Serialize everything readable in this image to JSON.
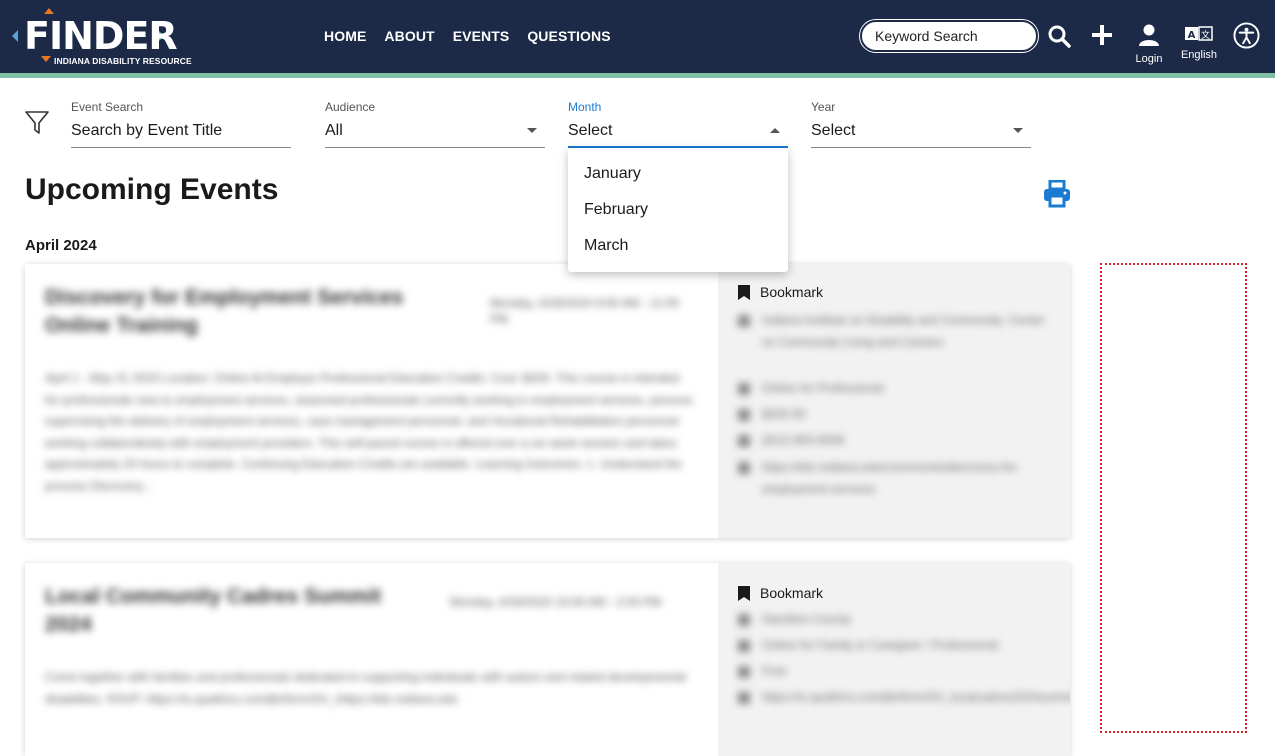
{
  "header": {
    "logo_text": "FINDER",
    "logo_subtext": "INDIANA DISABILITY RESOURCE",
    "nav": [
      "HOME",
      "ABOUT",
      "EVENTS",
      "QUESTIONS"
    ],
    "search_placeholder": "Keyword Search",
    "login_label": "Login",
    "language_label": "English",
    "icons": {
      "search": "search-icon",
      "add": "plus-icon",
      "login": "user-icon",
      "language": "translate-icon",
      "accessibility": "accessibility-icon"
    }
  },
  "colors": {
    "header_bg": "#1c2a48",
    "stripe": "#7fbfa5",
    "accent_blue": "#1a7bd1",
    "logo_orange": "#e87722"
  },
  "filters": {
    "event_search": {
      "label": "Event Search",
      "value": "Search by Event Title"
    },
    "audience": {
      "label": "Audience",
      "value": "All"
    },
    "month": {
      "label": "Month",
      "value": "Select",
      "open": true,
      "options": [
        "January",
        "February",
        "March"
      ]
    },
    "year": {
      "label": "Year",
      "value": "Select"
    }
  },
  "main": {
    "title": "Upcoming Events",
    "month_heading": "April 2024"
  },
  "events": [
    {
      "title": "Discovery for Employment Services Online Training",
      "date": "Monday, 4/29/2024 9:00 AM - 11:00 PM",
      "description": "April 1 - May 31 2024 Location: Online At Employer Professional Education Credits: Cost: $200. This course is intended for professionals new to employment services, seasoned professionals currently working in employment services, persons supervising the delivery of employment services, case management personnel, and Vocational Rehabilitation personnel working collaboratively with employment providers. This self-paced course is offered over a six week session and takes approximately 20 hours to complete. Continuing Education Credits are available. Learning Outcomes: 1. Understand the process Discovery...",
      "bookmark_label": "Bookmark",
      "meta": [
        "Indiana Institute on Disability and Community: Center on Community Living and Careers",
        "Online for Professional",
        "$200.00",
        "(812) 855-6508",
        "https://iidc.indiana.edu/cclc/events/discovery-for-employment-services"
      ]
    },
    {
      "title": "Local Community Cadres Summit 2024",
      "date": "Monday, 4/29/2024 10:00 AM - 2:00 PM",
      "description": "Come together with families and professionals dedicated to supporting individuals with autism and related developmental disabilities. RSVP: https://iu.qualtrics.com/jfe/form/SV_/https://iidc.indiana.edu",
      "bookmark_label": "Bookmark",
      "meta": [
        "Hamilton County",
        "Online for Family or Caregiver / Professional",
        "Free",
        "https://iu.qualtrics.com/jfe/form/SV_localcadres2024summit"
      ]
    }
  ]
}
